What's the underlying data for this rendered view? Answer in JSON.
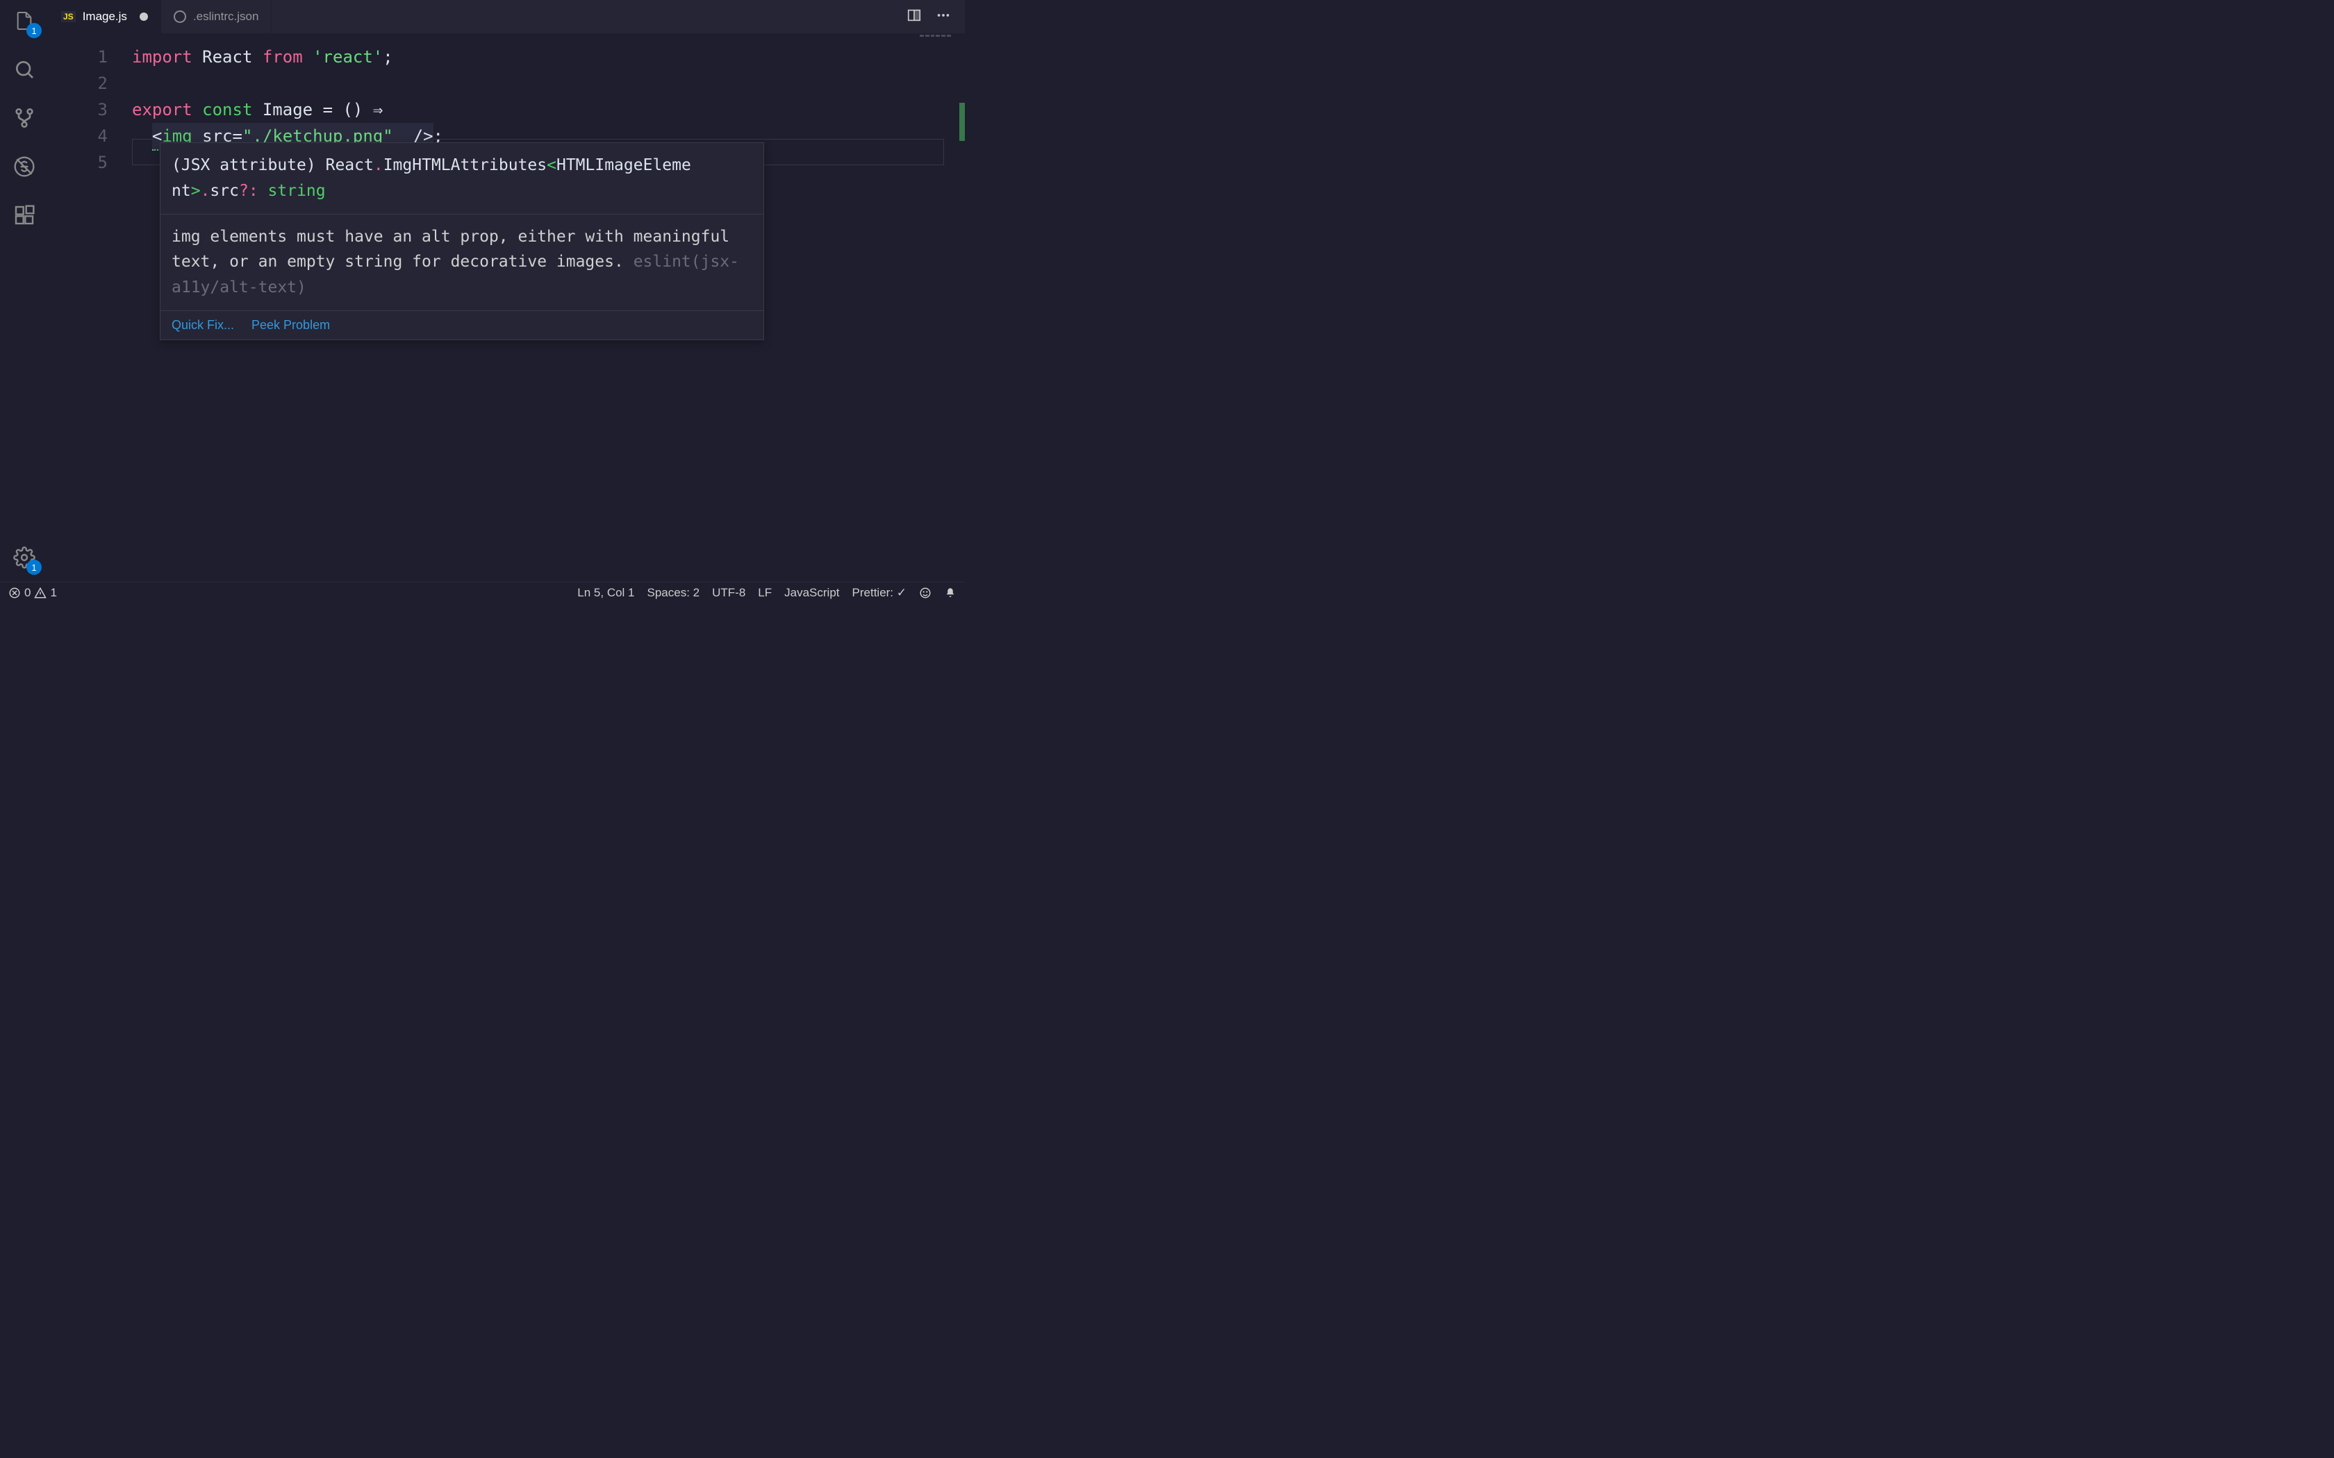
{
  "tabs": [
    {
      "icon": "JS",
      "name": "Image.js",
      "active": true,
      "modified": true
    },
    {
      "icon": "json",
      "name": ".eslintrc.json",
      "active": false,
      "modified": false
    }
  ],
  "activity_bar": {
    "explorer_badge": "1",
    "settings_badge": "1"
  },
  "gutter": [
    "1",
    "2",
    "3",
    "4",
    "5"
  ],
  "code": {
    "line1": {
      "import": "import",
      "react": "React",
      "from": "from",
      "string": "'react'",
      "semi": ";"
    },
    "line3": {
      "export": "export",
      "const": "const",
      "ident": "Image",
      "eq": "=",
      "parens": "()",
      "arrow": "⇒"
    },
    "line4": {
      "lt": "<",
      "tag": "img",
      "attr": "src",
      "eq": "=",
      "value": "\"./ketchup.png\"",
      "close": "/>",
      "semi": ";"
    }
  },
  "hover": {
    "sig_prefix": "(JSX attribute)",
    "sig_react": "React",
    "sig_type1": "ImgHTMLAttributes",
    "sig_type2": "HTMLImageEleme",
    "sig_type2b": "nt",
    "sig_prop": "src",
    "sig_optional": "?:",
    "sig_str": "string",
    "diagnostic": "img elements must have an alt prop, either with meaningful text, or an empty string for decorative images.",
    "rule": "eslint(jsx-a11y/alt-text)",
    "quick_fix": "Quick Fix...",
    "peek": "Peek Problem"
  },
  "status": {
    "errors": "0",
    "warnings": "1",
    "ln_col": "Ln 5, Col 1",
    "spaces": "Spaces: 2",
    "encoding": "UTF-8",
    "eol": "LF",
    "language": "JavaScript",
    "formatter": "Prettier: ✓"
  }
}
